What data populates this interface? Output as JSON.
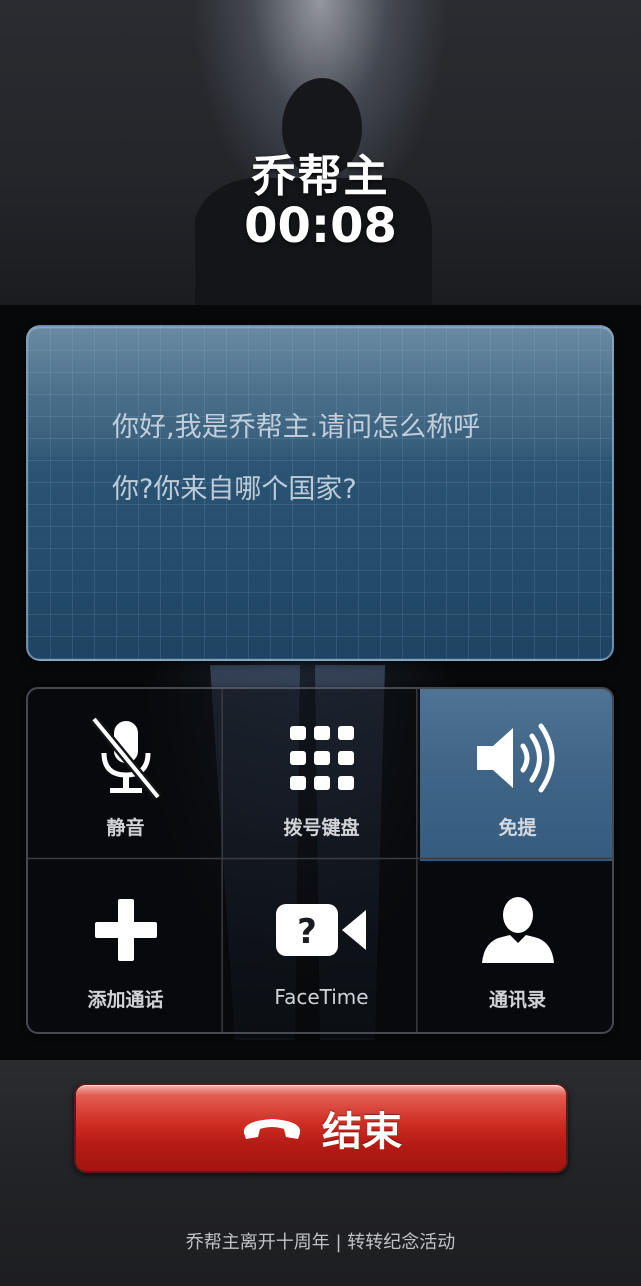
{
  "call": {
    "caller_name": "乔帮主",
    "timer": "00:08"
  },
  "message": {
    "line1": "你好,我是乔帮主.请问怎么称呼",
    "line2": "你?你来自哪个国家?"
  },
  "controls": {
    "mute": {
      "label": "静音",
      "icon": "microphone-muted-icon"
    },
    "keypad": {
      "label": "拨号键盘",
      "icon": "keypad-grid-icon"
    },
    "speaker": {
      "label": "免提",
      "icon": "speaker-icon",
      "active": true
    },
    "add_call": {
      "label": "添加通话",
      "icon": "plus-icon"
    },
    "facetime": {
      "label": "FaceTime",
      "icon": "facetime-video-icon"
    },
    "contacts": {
      "label": "通讯录",
      "icon": "contact-person-icon"
    }
  },
  "end_call": {
    "label": "结束",
    "icon": "hang-up-phone-icon"
  },
  "footer": {
    "caption": "乔帮主离开十周年 | 转转纪念活动"
  },
  "colors": {
    "active_tile": "#3e6486",
    "end_button": "#cf2c22",
    "panel": "#2a5372"
  }
}
